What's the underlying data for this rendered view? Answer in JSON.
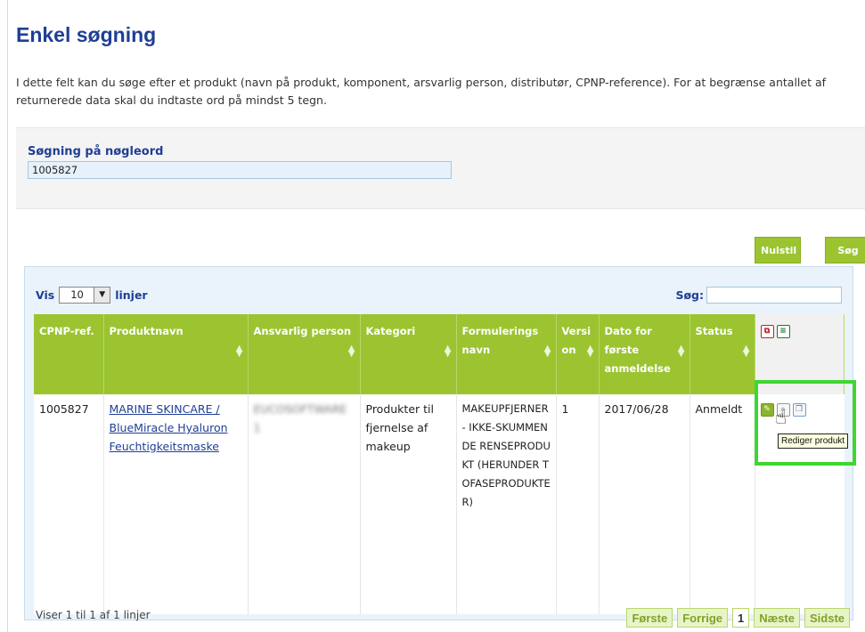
{
  "page": {
    "title": "Enkel søgning",
    "intro": "I dette felt kan du søge efter et produkt (navn på produkt, komponent, arsvarlig person, distributør, CPNP-reference). For at begrænse antallet af returnerede data skal du indtaste ord på mindst 5 tegn."
  },
  "search": {
    "label": "Søgning på nøgleord",
    "value": "1005827"
  },
  "buttons": {
    "reset": "Nulstil",
    "search": "Søg"
  },
  "results": {
    "show_prefix": "Vis",
    "show_value": "10",
    "show_suffix": "linjer",
    "filter_label": "Søg:",
    "columns": [
      "CPNP-ref.",
      "Produktnavn",
      "Ansvarlig person",
      "Kategori",
      "Formulerings navn",
      "Versi on",
      "Dato for første anmeldelse",
      "Status"
    ],
    "rows": [
      {
        "cpnp": "1005827",
        "product_name": "MARINE SKINCARE / BlueMiracle Hyaluron Feuchtigkeitsmaske",
        "responsible_person": "EUCOSOFTWARE 1",
        "category": "Produkter til fjernelse af makeup",
        "formulation": "MAKEUPFJERNER - IKKE-SKUMMENDE RENSEPRODUKT (HERUNDER TOFASEPRODUKTER)",
        "version": "1",
        "date": "2017/06/28",
        "status": "Anmeldt"
      }
    ],
    "tooltip": "Rediger produkt",
    "info": "Viser 1 til 1 af 1 linjer"
  },
  "pagination": {
    "first": "Første",
    "previous": "Forrige",
    "current": "1",
    "next": "Næste",
    "last": "Sidste"
  },
  "icons": {
    "export": [
      "pdf-icon",
      "excel-icon"
    ],
    "row_actions": [
      "edit-icon",
      "view-icon",
      "copy-icon"
    ]
  }
}
